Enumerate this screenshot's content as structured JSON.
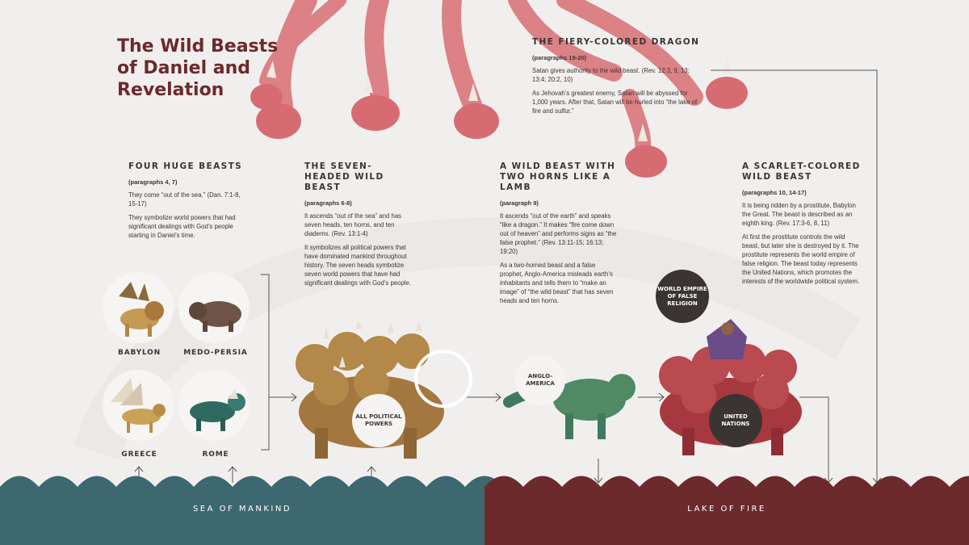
{
  "title": "The Wild Beasts of Daniel and Revelation",
  "dragon": {
    "title": "THE FIERY-COLORED DRAGON",
    "paragraphs": "(paragraphs 19-20)",
    "text1": "Satan gives authority to the wild beast. (Rev. 12:3, 9, 13; 13:4; 20:2, 10)",
    "text2": "As Jehovah’s greatest enemy, Satan will be abyssed for 1,000 years. After that, Satan will be hurled into “the lake of fire and sulfur.”"
  },
  "four_beasts": {
    "title": "FOUR HUGE BEASTS",
    "paragraphs": "(paragraphs 4, 7)",
    "text1": "They come “out of the sea.” (Dan. 7:1-8, 15-17)",
    "text2": "They symbolize world powers that had significant dealings with God’s people starting in Daniel’s time.",
    "beasts": [
      "BABYLON",
      "MEDO-PERSIA",
      "GREECE",
      "ROME"
    ]
  },
  "seven_headed": {
    "title": "THE SEVEN-HEADED WILD BEAST",
    "paragraphs": "(paragraphs 6-8)",
    "text1": "It ascends “out of the sea” and has seven heads, ten horns, and ten diadems. (Rev. 13:1-4)",
    "text2": "It symbolizes all political powers that have dominated mankind throughout history. The seven heads symbolize seven world powers that have had significant dealings with God’s people.",
    "badge": "ALL POLITICAL POWERS"
  },
  "two_horns": {
    "title": "A WILD BEAST WITH TWO HORNS LIKE A LAMB",
    "paragraphs": "(paragraph 9)",
    "text1": "It ascends “out of the earth” and speaks “like a dragon.” It makes “fire come down out of heaven” and performs signs as “the false prophet.” (Rev. 13:11-15; 16:13; 19:20)",
    "text2": "As a two-horned beast and a false prophet, Anglo-America misleads earth’s inhabitants and tells them to “make an image” of “the wild beast” that has seven heads and ten horns.",
    "badge": "ANGLO-AMERICA"
  },
  "scarlet": {
    "title": "A SCARLET-COLORED WILD BEAST",
    "paragraphs": "(paragraphs 10, 14-17)",
    "text1": "It is being ridden by a prostitute, Babylon the Great. The beast is described as an eighth king. (Rev. 17:3-6, 8, 11)",
    "text2": "At first the prostitute controls the wild beast, but later she is destroyed by it. The prostitute represents the world empire of false religion. The beast today represents the United Nations, which promotes the interests of the worldwide political system.",
    "badge_religion": "WORLD EMPIRE OF FALSE RELIGION",
    "badge_un": "UNITED NATIONS"
  },
  "sea_label": "SEA OF MANKIND",
  "lake_label": "LAKE OF FIRE",
  "colors": {
    "sea": "#3e6870",
    "lake": "#6c2a2d",
    "title": "#6b2a2d",
    "dragon": "#d9787c"
  }
}
